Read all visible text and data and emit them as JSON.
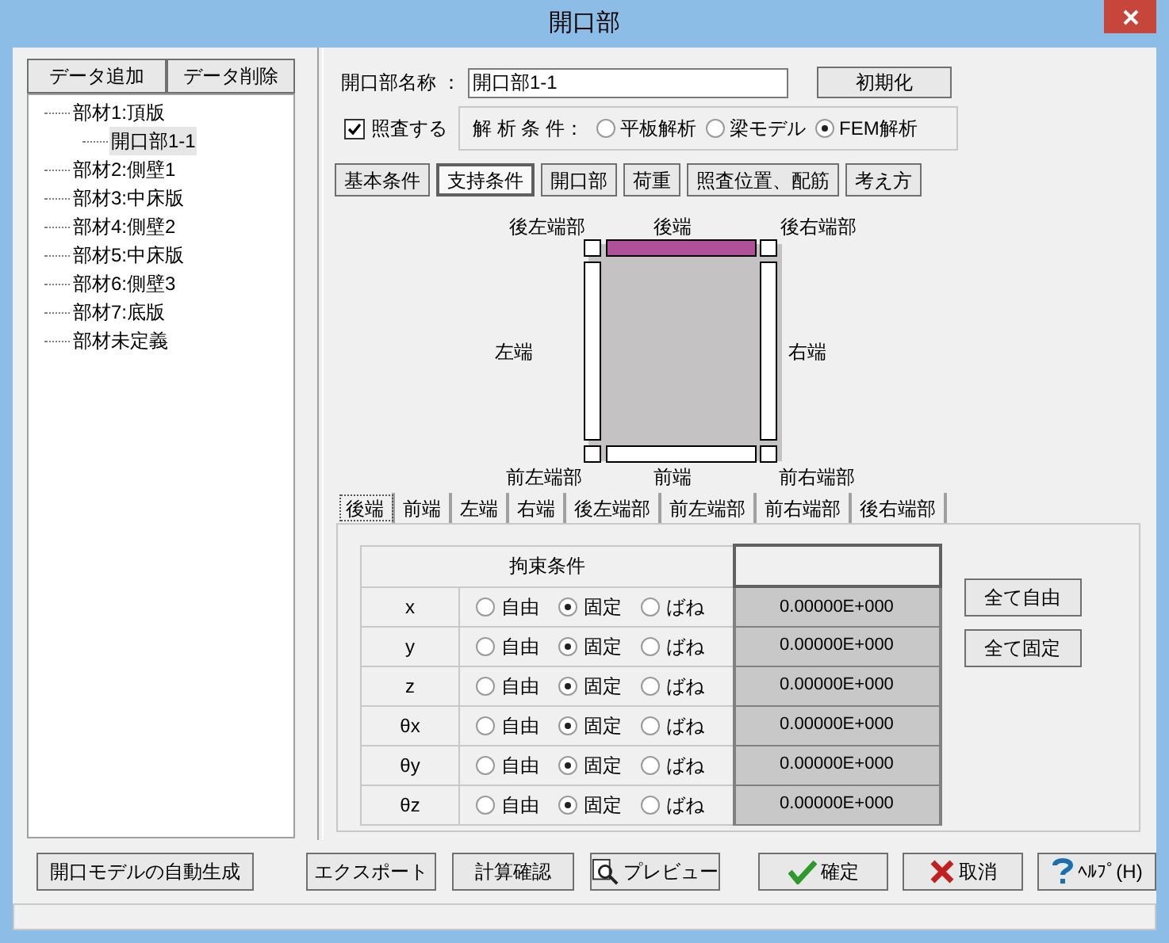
{
  "window": {
    "title": "開口部"
  },
  "left_buttons": [
    "データ追加",
    "データ削除"
  ],
  "tree": [
    {
      "label": "部材1:頂版",
      "selected": false,
      "children": [
        {
          "label": "開口部1-1",
          "selected": true
        }
      ]
    },
    {
      "label": "部材2:側壁1",
      "selected": false
    },
    {
      "label": "部材3:中床版",
      "selected": false
    },
    {
      "label": "部材4:側壁2",
      "selected": false
    },
    {
      "label": "部材5:中床版",
      "selected": false
    },
    {
      "label": "部材6:側壁3",
      "selected": false
    },
    {
      "label": "部材7:底版",
      "selected": false
    },
    {
      "label": "部材未定義",
      "selected": false
    }
  ],
  "name_field": {
    "label": "開口部名称 ：",
    "value": "開口部1-1"
  },
  "reset_button": "初期化",
  "check": {
    "label": "照査する",
    "checked": true
  },
  "analysis": {
    "label": "解 析 条 件：",
    "options": [
      {
        "label": "平板解析",
        "selected": false
      },
      {
        "label": "梁モデル",
        "selected": false
      },
      {
        "label": "FEM解析",
        "selected": true
      }
    ]
  },
  "tabs": [
    {
      "label": "基本条件",
      "selected": false
    },
    {
      "label": "支持条件",
      "selected": true
    },
    {
      "label": "開口部",
      "selected": false
    },
    {
      "label": "荷重",
      "selected": false
    },
    {
      "label": "照査位置、配筋",
      "selected": false
    },
    {
      "label": "考え方",
      "selected": false
    }
  ],
  "diagram": [
    {
      "label": "後左端部",
      "selected": false
    },
    {
      "label": "後端",
      "selected": true
    },
    {
      "label": "後右端部",
      "selected": false
    },
    {
      "label": "左端",
      "selected": false
    },
    {
      "label": "右端",
      "selected": false
    },
    {
      "label": "前左端部",
      "selected": false
    },
    {
      "label": "前端",
      "selected": false
    },
    {
      "label": "前右端部",
      "selected": false
    }
  ],
  "sub_tabs": [
    {
      "label": "後端",
      "selected": true
    },
    {
      "label": "前端",
      "selected": false
    },
    {
      "label": "左端",
      "selected": false
    },
    {
      "label": "右端",
      "selected": false
    },
    {
      "label": "後左端部",
      "selected": false
    },
    {
      "label": "前左端部",
      "selected": false
    },
    {
      "label": "前右端部",
      "selected": false
    },
    {
      "label": "後右端部",
      "selected": false
    }
  ],
  "table": {
    "header": "拘束条件",
    "rows": [
      {
        "label": "x",
        "options": [
          {
            "label": "自由",
            "selected": false
          },
          {
            "label": "固定",
            "selected": true
          },
          {
            "label": "ばね",
            "selected": false
          }
        ],
        "value": "0.00000E+000"
      },
      {
        "label": "y",
        "options": [
          {
            "label": "自由",
            "selected": false
          },
          {
            "label": "固定",
            "selected": true
          },
          {
            "label": "ばね",
            "selected": false
          }
        ],
        "value": "0.00000E+000"
      },
      {
        "label": "z",
        "options": [
          {
            "label": "自由",
            "selected": false
          },
          {
            "label": "固定",
            "selected": true
          },
          {
            "label": "ばね",
            "selected": false
          }
        ],
        "value": "0.00000E+000"
      },
      {
        "label": "θx",
        "options": [
          {
            "label": "自由",
            "selected": false
          },
          {
            "label": "固定",
            "selected": true
          },
          {
            "label": "ばね",
            "selected": false
          }
        ],
        "value": "0.00000E+000"
      },
      {
        "label": "θy",
        "options": [
          {
            "label": "自由",
            "selected": false
          },
          {
            "label": "固定",
            "selected": true
          },
          {
            "label": "ばね",
            "selected": false
          }
        ],
        "value": "0.00000E+000"
      },
      {
        "label": "θz",
        "options": [
          {
            "label": "自由",
            "selected": false
          },
          {
            "label": "固定",
            "selected": true
          },
          {
            "label": "ばね",
            "selected": false
          }
        ],
        "value": "0.00000E+000"
      }
    ]
  },
  "side_buttons": [
    "全て自由",
    "全て固定"
  ],
  "footer_buttons": [
    {
      "label": "開口モデルの自動生成",
      "kind": "plain"
    },
    {
      "label": "エクスポート",
      "kind": "plain"
    },
    {
      "label": "計算確認",
      "kind": "plain"
    },
    {
      "label": "プレビュー",
      "kind": "preview"
    },
    {
      "label": "確定",
      "kind": "ok"
    },
    {
      "label": "取消",
      "kind": "cancel"
    },
    {
      "label": "ﾍﾙﾌﾟ(H)",
      "kind": "help"
    }
  ]
}
